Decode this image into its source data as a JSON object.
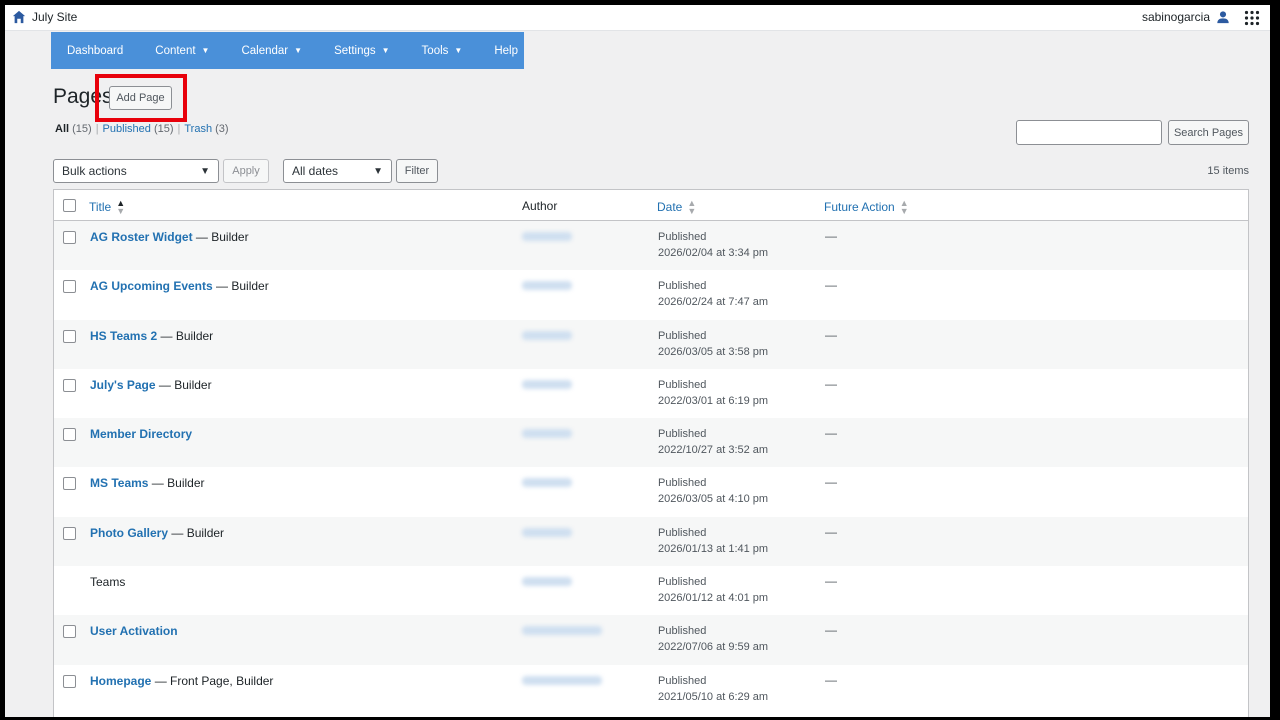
{
  "topbar": {
    "site_name": "July Site",
    "username": "sabinogarcia"
  },
  "nav": [
    {
      "label": "Dashboard",
      "dropdown": false
    },
    {
      "label": "Content",
      "dropdown": true
    },
    {
      "label": "Calendar",
      "dropdown": true
    },
    {
      "label": "Settings",
      "dropdown": true
    },
    {
      "label": "Tools",
      "dropdown": true
    },
    {
      "label": "Help",
      "dropdown": false
    }
  ],
  "page": {
    "title": "Pages",
    "add_button": "Add Page"
  },
  "status_links": {
    "all": "All",
    "all_count": "(15)",
    "published": "Published",
    "published_count": "(15)",
    "trash": "Trash",
    "trash_count": "(3)"
  },
  "search": {
    "placeholder": "",
    "button": "Search Pages"
  },
  "filters": {
    "bulk_actions": "Bulk actions",
    "apply": "Apply",
    "dates": "All dates",
    "filter": "Filter"
  },
  "items_count": "15 items",
  "table": {
    "columns": {
      "title": "Title",
      "author": "Author",
      "date": "Date",
      "future": "Future Action"
    },
    "rows": [
      {
        "title": "AG Roster Widget",
        "state": " — Builder",
        "status": "Published",
        "datetime": "2026/02/04 at 3:34 pm",
        "future": "—"
      },
      {
        "title": "AG Upcoming Events",
        "state": " — Builder",
        "status": "Published",
        "datetime": "2026/02/24 at 7:47 am",
        "future": "—"
      },
      {
        "title": "HS Teams 2",
        "state": " — Builder",
        "status": "Published",
        "datetime": "2026/03/05 at 3:58 pm",
        "future": "—"
      },
      {
        "title": "July's Page",
        "state": " — Builder",
        "status": "Published",
        "datetime": "2022/03/01 at 6:19 pm",
        "future": "—"
      },
      {
        "title": "Member Directory",
        "state": "",
        "status": "Published",
        "datetime": "2022/10/27 at 3:52 am",
        "future": "—"
      },
      {
        "title": "MS Teams",
        "state": " — Builder",
        "status": "Published",
        "datetime": "2026/03/05 at 4:10 pm",
        "future": "—"
      },
      {
        "title": "Photo Gallery",
        "state": " — Builder",
        "status": "Published",
        "datetime": "2026/01/13 at 1:41 pm",
        "future": "—"
      },
      {
        "title": "Teams",
        "state": "",
        "status": "Published",
        "datetime": "2026/01/12 at 4:01 pm",
        "future": "—",
        "plain": true
      },
      {
        "title": "User Activation",
        "state": "",
        "status": "Published",
        "datetime": "2022/07/06 at 9:59 am",
        "future": "—"
      },
      {
        "title": "Homepage",
        "state": " — Front Page, Builder",
        "status": "Published",
        "datetime": "2021/05/10 at 6:29 am",
        "future": "—"
      }
    ]
  },
  "colors": {
    "nav_bg": "#4a90d9",
    "link": "#2271b1",
    "highlight": "#e8000b"
  }
}
